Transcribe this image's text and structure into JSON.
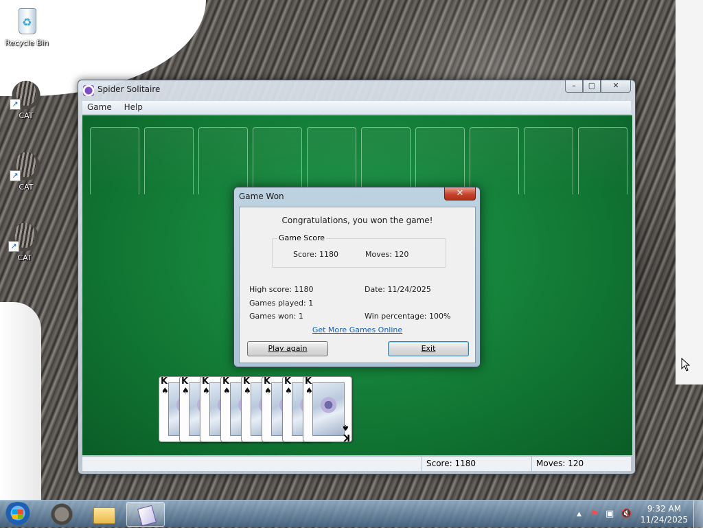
{
  "desktop": {
    "icons": [
      {
        "label": "Recycle Bin",
        "icon": "recycle-bin-icon"
      },
      {
        "label": "CAT",
        "icon": "cat-shortcut-icon"
      },
      {
        "label": "CAT",
        "icon": "cat-shortcut-icon"
      },
      {
        "label": "CAT",
        "icon": "cat-shortcut-icon"
      }
    ]
  },
  "window": {
    "title": "Spider Solitaire",
    "controls": {
      "minimize": "–",
      "maximize": "▢",
      "close": "✕"
    },
    "menu": [
      "Game",
      "Help"
    ],
    "status": {
      "score": "Score: 1180",
      "moves": "Moves:  120"
    },
    "completed_cards": [
      {
        "rank": "K",
        "suit": "♠"
      },
      {
        "rank": "K",
        "suit": "♠"
      },
      {
        "rank": "K",
        "suit": "♠"
      },
      {
        "rank": "K",
        "suit": "♠"
      },
      {
        "rank": "K",
        "suit": "♠"
      },
      {
        "rank": "K",
        "suit": "♠"
      },
      {
        "rank": "K",
        "suit": "♠"
      },
      {
        "rank": "K",
        "suit": "♠"
      }
    ]
  },
  "dialog": {
    "title": "Game Won",
    "close": "✕",
    "message": "Congratulations, you won the game!",
    "group_label": "Game Score",
    "score": "Score: 1180",
    "moves": "Moves: 120",
    "high_score": "High score: 1180",
    "date": "Date: 11/24/2025",
    "games_played": "Games played: 1",
    "games_won": "Games won: 1",
    "win_percentage": "Win percentage: 100%",
    "link": "Get More Games Online",
    "play_again": "Play again",
    "exit": "Exit"
  },
  "taskbar": {
    "pinned": [
      "cat-icon",
      "folder-icon",
      "spider-solitaire-icon"
    ],
    "active": "spider-solitaire-icon",
    "tray": {
      "arrow": "▲",
      "flag": "⚑",
      "network": "▣",
      "volume": "🔇"
    },
    "time": "9:32 AM",
    "date": "11/24/2025"
  },
  "colors": {
    "felt": "#127a35",
    "link": "#1160c8",
    "close_red": "#c8442c"
  }
}
